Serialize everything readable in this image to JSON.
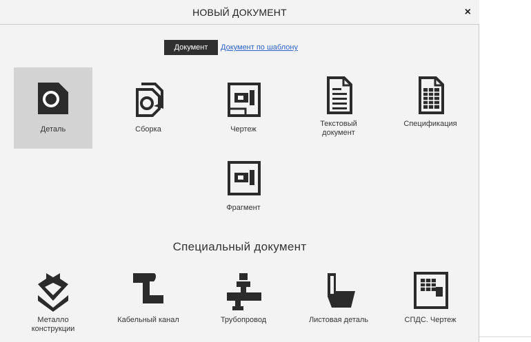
{
  "dialog": {
    "title": "НОВЫЙ ДОКУМЕНТ",
    "close_label": "×"
  },
  "tabs": {
    "active": "Документ",
    "link": "Документ по шаблону"
  },
  "documents": [
    {
      "label": "Деталь",
      "icon": "part-icon",
      "selected": true
    },
    {
      "label": "Сборка",
      "icon": "assembly-icon"
    },
    {
      "label": "Чертеж",
      "icon": "drawing-icon"
    },
    {
      "label": "Текстовый документ",
      "icon": "text-document-icon"
    },
    {
      "label": "Спецификация",
      "icon": "specification-icon"
    },
    {
      "label": "Фрагмент",
      "icon": "fragment-icon"
    }
  ],
  "special_title": "Специальный документ",
  "special_documents": [
    {
      "label": "Металло конструкции",
      "icon": "metal-structures-icon"
    },
    {
      "label": "Кабельный канал",
      "icon": "cable-channel-icon"
    },
    {
      "label": "Трубопровод",
      "icon": "pipeline-icon"
    },
    {
      "label": "Листовая деталь",
      "icon": "sheet-part-icon"
    },
    {
      "label": "СПДС. Чертеж",
      "icon": "spds-drawing-icon"
    }
  ]
}
